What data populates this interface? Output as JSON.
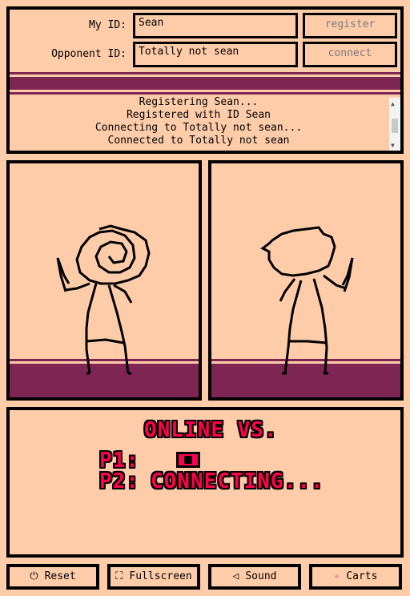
{
  "connection": {
    "my_id_label": "My ID:",
    "my_id_value": "Sean",
    "opponent_id_label": "Opponent ID:",
    "opponent_id_value": "Totally not sean",
    "register_label": "register",
    "connect_label": "connect",
    "log": [
      "Registering Sean...",
      "Registered with ID Sean",
      "Connecting to Totally not sean...",
      "Connected to Totally not sean"
    ]
  },
  "game": {
    "title": "ONLINE VS.",
    "p1_label": "P1:",
    "p2_label": "P2:",
    "p2_status": "CONNECTING..."
  },
  "controls": {
    "reset": "Reset",
    "fullscreen": "Fullscreen",
    "sound": "Sound",
    "carts": "Carts"
  },
  "icons": {
    "reset": "power-icon",
    "fullscreen": "fullscreen-icon",
    "sound": "speaker-icon",
    "carts": "carts-icon"
  },
  "colors": {
    "background": "#ffccaa",
    "floor": "#7e2553",
    "text_accent": "#ff004d"
  }
}
